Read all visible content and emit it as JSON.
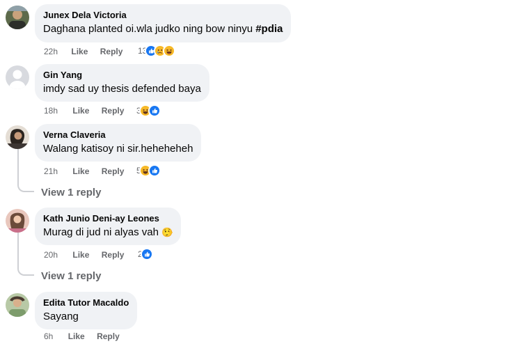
{
  "comments": [
    {
      "author": "Junex Dela Victoria",
      "text": "Daghana planted oi.wla judko ning bow ninyu ",
      "hashtag": "#pdia",
      "time": "22h",
      "like": "Like",
      "reply": "Reply",
      "reaction_count": "13",
      "reactions": [
        "like-icon",
        "sad-icon",
        "haha-icon"
      ]
    },
    {
      "author": "Gin Yang",
      "text": "imdy sad uy thesis defended baya",
      "time": "18h",
      "like": "Like",
      "reply": "Reply",
      "reaction_count": "3",
      "reactions": [
        "haha-icon",
        "like-icon"
      ]
    },
    {
      "author": "Verna Claveria",
      "text": "Walang katisoy ni sir.heheheheh",
      "time": "21h",
      "like": "Like",
      "reply": "Reply",
      "reaction_count": "5",
      "reactions": [
        "haha-icon",
        "like-icon"
      ],
      "view_replies": "View 1 reply"
    },
    {
      "author": "Kath Junio Deni-ay Leones",
      "text": "Murag di jud ni alyas vah ",
      "emoji": "🤥",
      "time": "20h",
      "like": "Like",
      "reply": "Reply",
      "reaction_count": "2",
      "reactions": [
        "like-icon"
      ],
      "view_replies": "View 1 reply"
    },
    {
      "author": "Edita Tutor Macaldo",
      "text": "Sayang",
      "time": "6h",
      "like": "Like",
      "reply": "Reply"
    }
  ],
  "colors": {
    "bubble": "#f0f2f5",
    "meta": "#65676b",
    "like_blue": "#1877f2",
    "haha_yellow": "#f7b928",
    "thread_line": "#ced0d4"
  }
}
